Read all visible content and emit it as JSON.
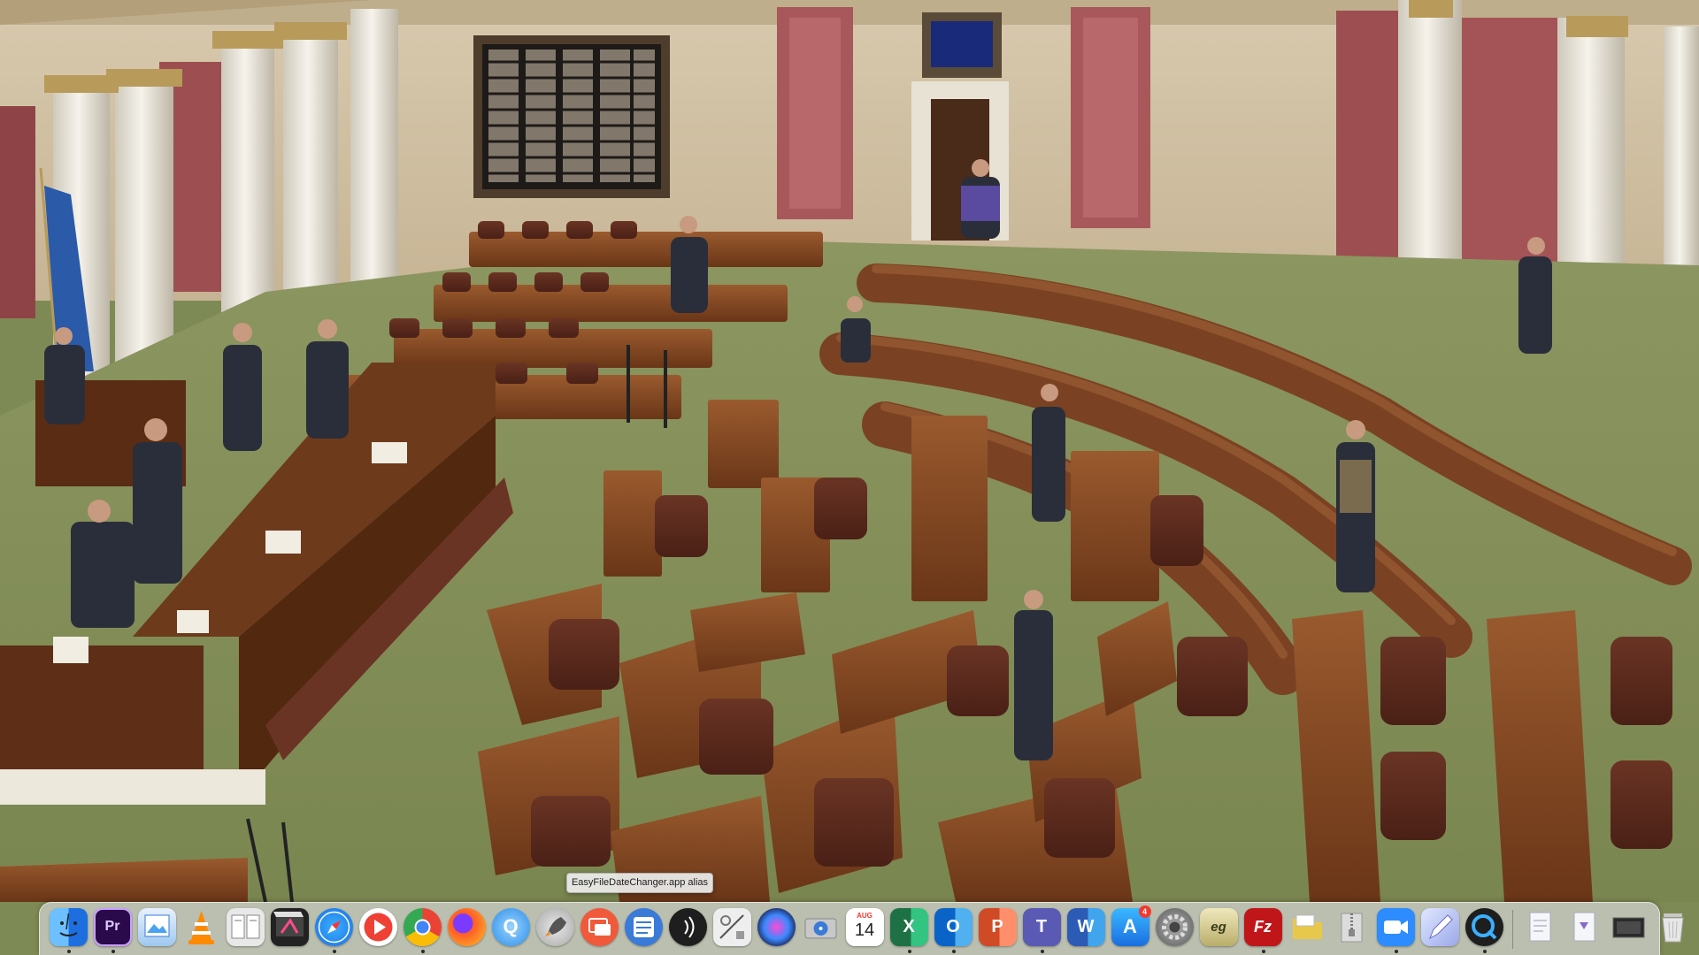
{
  "tooltip": {
    "text": "EasyFileDateChanger.app alias"
  },
  "dock": {
    "items": [
      {
        "name": "finder",
        "glyph": "",
        "color": "#3d8ef2",
        "running": true
      },
      {
        "name": "premiere-pro",
        "glyph": "Pr",
        "color": "#2a0a4a",
        "running": true
      },
      {
        "name": "preview",
        "glyph": "",
        "color": "#4aa3f0",
        "running": false
      },
      {
        "name": "vlc",
        "glyph": "",
        "color": "#f3f3f3",
        "running": false
      },
      {
        "name": "file-merge",
        "glyph": "",
        "color": "#e8e8e8",
        "running": false
      },
      {
        "name": "final-cut-pro",
        "glyph": "",
        "color": "#222222",
        "running": false
      },
      {
        "name": "safari",
        "glyph": "",
        "color": "#ffffff",
        "running": true
      },
      {
        "name": "infuse",
        "glyph": "",
        "color": "#ee4035",
        "running": false
      },
      {
        "name": "chrome",
        "glyph": "",
        "color": "#ffffff",
        "running": true
      },
      {
        "name": "firefox",
        "glyph": "",
        "color": "#ff7a1a",
        "running": false
      },
      {
        "name": "quicktime",
        "glyph": "Q",
        "color": "#2a8ee8",
        "running": false
      },
      {
        "name": "launchpad",
        "glyph": "",
        "color": "#d8d8d8",
        "running": false
      },
      {
        "name": "screen-sharing",
        "glyph": "",
        "color": "#f05a3a",
        "running": false
      },
      {
        "name": "system-information",
        "glyph": "",
        "color": "#3a7ad8",
        "running": false
      },
      {
        "name": "audio-hijack",
        "glyph": "",
        "color": "#1e1e1e",
        "running": false
      },
      {
        "name": "directory-utility",
        "glyph": "",
        "color": "#eeeeee",
        "running": false
      },
      {
        "name": "siri",
        "glyph": "",
        "color": "#2a2a6a",
        "running": false
      },
      {
        "name": "disk-utility",
        "glyph": "",
        "color": "#d0d0d0",
        "running": false
      },
      {
        "name": "calendar",
        "glyph": "14",
        "month": "AUG",
        "color": "#ffffff",
        "running": false
      },
      {
        "name": "excel",
        "glyph": "X",
        "color": "#1e7145",
        "running": true
      },
      {
        "name": "outlook",
        "glyph": "O",
        "color": "#0a64c8",
        "running": true
      },
      {
        "name": "powerpoint",
        "glyph": "P",
        "color": "#d04a26",
        "running": false
      },
      {
        "name": "teams",
        "glyph": "T",
        "color": "#5a5ab4",
        "running": true
      },
      {
        "name": "word",
        "glyph": "W",
        "color": "#2b5bb5",
        "running": false
      },
      {
        "name": "app-store",
        "glyph": "A",
        "color": "#1a8cf0",
        "badge": "4",
        "running": false
      },
      {
        "name": "system-preferences",
        "glyph": "",
        "color": "#8a8a8a",
        "running": false
      },
      {
        "name": "easy-file-date-changer",
        "glyph": "eg",
        "color": "#d9d2a0",
        "running": false
      },
      {
        "name": "filezilla",
        "glyph": "Fz",
        "color": "#c0161a",
        "running": true
      },
      {
        "name": "finder-folder",
        "glyph": "",
        "color": "#e8c84a",
        "running": false
      },
      {
        "name": "archive-utility",
        "glyph": "",
        "color": "#dcdcdc",
        "running": false
      },
      {
        "name": "zoom",
        "glyph": "",
        "color": "#2d8cff",
        "running": true
      },
      {
        "name": "notes-app",
        "glyph": "",
        "color": "#b8c8f0",
        "running": false
      },
      {
        "name": "quicktime-player",
        "glyph": "",
        "color": "#1e1e1e",
        "running": true
      }
    ],
    "right_items": [
      {
        "name": "documents-stack",
        "color": "#e6eaf0"
      },
      {
        "name": "downloads-stack",
        "color": "#e6eaf0"
      },
      {
        "name": "screenshot-stack",
        "color": "#2a2a2a"
      },
      {
        "name": "trash",
        "color": "#e6e6e6"
      }
    ]
  }
}
